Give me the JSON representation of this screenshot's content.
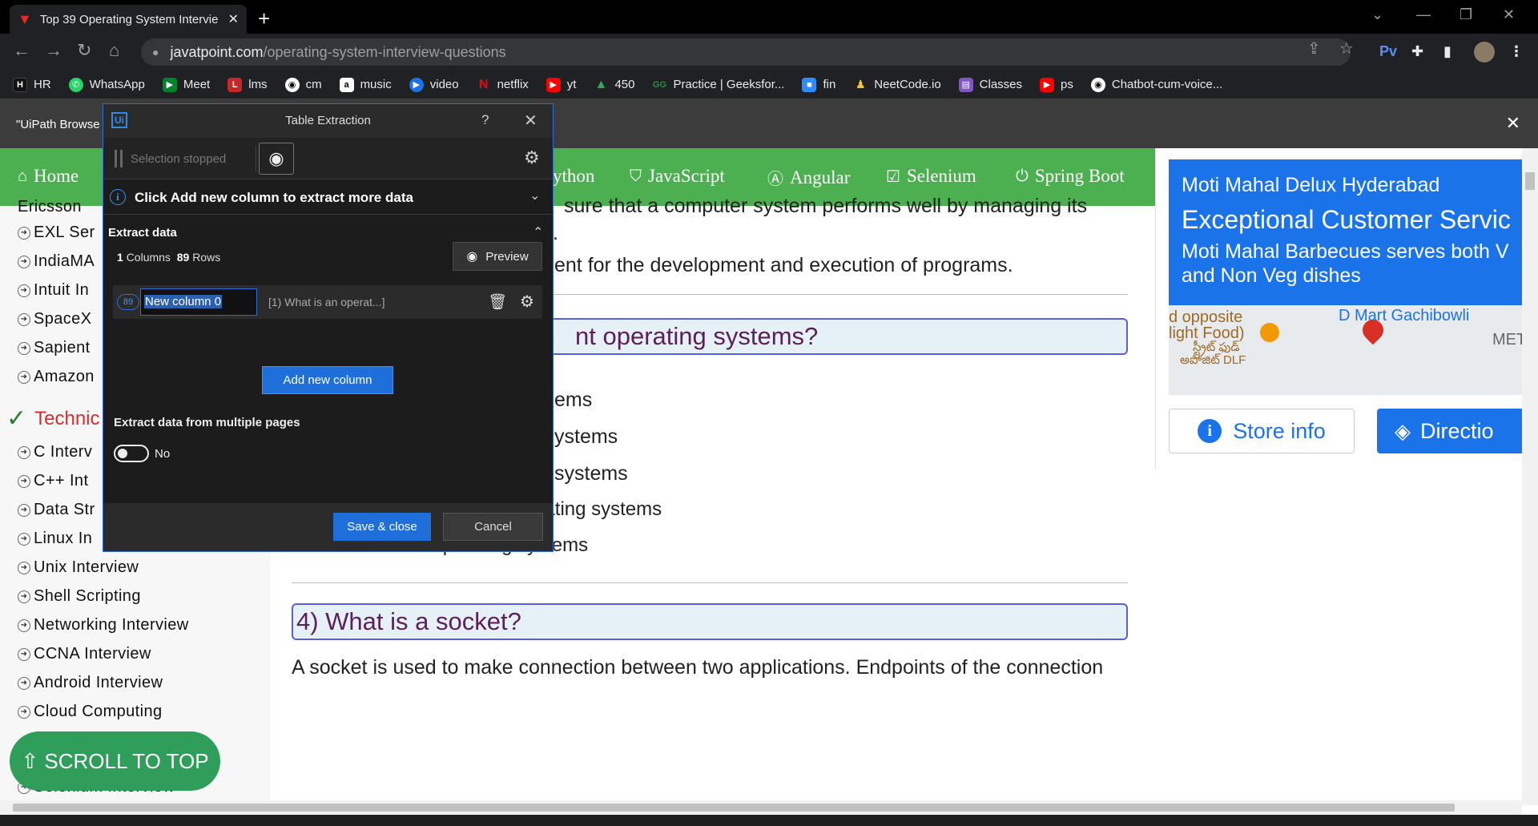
{
  "browser": {
    "tab_title": "Top 39 Operating System Intervie",
    "url_host": "javatpoint.com",
    "url_path": "/operating-system-interview-questions",
    "ext_label": "Pv",
    "bookmarks": [
      "HR",
      "WhatsApp",
      "Meet",
      "lms",
      "cm",
      "music",
      "video",
      "netflix",
      "yt",
      "450",
      "Practice | Geeksfor...",
      "fin",
      "NeetCode.io",
      "Classes",
      "ps",
      "Chatbot-cum-voice..."
    ]
  },
  "infobar": {
    "message": "\"UiPath Browse"
  },
  "site_nav": {
    "home": "Home",
    "python": "ython",
    "javascript": "JavaScript",
    "angular": "Angular",
    "selenium": "Selenium",
    "springboot": "Spring Boot"
  },
  "sidebar": {
    "ericsson": "Ericsson",
    "links_top": [
      "EXL Ser",
      "IndiaMA",
      "Intuit In",
      "SpaceX",
      "Sapient",
      "Amazon"
    ],
    "technical": "Technic",
    "links_bottom": [
      "C Interv",
      "C++ Int",
      "Data Str",
      "Linux In",
      "Unix Interview",
      "Shell Scripting",
      "Networking Interview",
      "CCNA Interview",
      "Android Interview",
      "Cloud Computing"
    ],
    "scroll_to_top": "⇧ SCROLL TO TOP",
    "selenium_cut": "Selenium Interview"
  },
  "content": {
    "line1": "sure that a computer system performs well by managing its",
    "line1b": ".",
    "line2": "ent for the development and execution of programs.",
    "q3_fragment": "nt operating systems?",
    "b1": "ems",
    "b2": "ystems",
    "b3": "systems",
    "b4": "Multi-programmed operating systems",
    "b5": "Real-time operating systems",
    "q4": "4) What is a socket?",
    "p4": "A socket is used to make connection between two applications. Endpoints of the connection"
  },
  "ad": {
    "name": "Moti Mahal Delux Hyderabad",
    "headline": "Exceptional Customer Servic",
    "body": "Moti Mahal Barbecues serves both V and Non Veg dishes",
    "map_label1": "d opposite",
    "map_label2": "light Food)",
    "map_label3": "స్ట్రీట్ ఫుడ్",
    "map_label4": "అపోజిట్ DLF",
    "map_label5": "D Mart Gachibowli",
    "map_label6": "MET",
    "store_info": "Store info",
    "directions": "Directio"
  },
  "dialog": {
    "title": "Table Extraction",
    "help": "?",
    "selection_status": "Selection stopped",
    "hint": "Click Add new column to extract more data",
    "extract_header": "Extract data",
    "columns_count": "1",
    "columns_label": "Columns",
    "rows_count": "89",
    "rows_label": "Rows",
    "preview": "Preview",
    "column_index": "89",
    "column_name": "New column 0",
    "column_value": "[1) What is an operat...]",
    "add_column": "Add new column",
    "multi_pages": "Extract data from multiple pages",
    "toggle_state": "No",
    "save_close": "Save & close",
    "cancel": "Cancel"
  }
}
